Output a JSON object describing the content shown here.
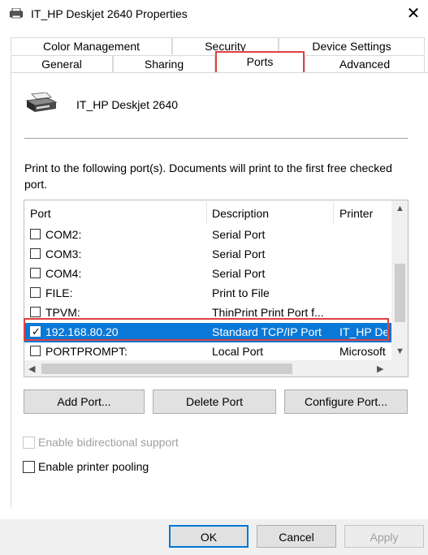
{
  "window": {
    "title": "IT_HP Deskjet 2640 Properties",
    "close_glyph": "✕"
  },
  "tabs_top": [
    {
      "label": "Color Management"
    },
    {
      "label": "Security"
    },
    {
      "label": "Device Settings"
    }
  ],
  "tabs_bottom": [
    {
      "label": "General"
    },
    {
      "label": "Sharing"
    },
    {
      "label": "Ports",
      "active": true
    },
    {
      "label": "Advanced"
    }
  ],
  "printer": {
    "name": "IT_HP Deskjet 2640"
  },
  "instructions": "Print to the following port(s). Documents will print to the first free checked port.",
  "ports_table": {
    "columns": [
      "Port",
      "Description",
      "Printer"
    ],
    "rows": [
      {
        "port": "COM2:",
        "description": "Serial Port",
        "printer": "",
        "checked": false,
        "selected": false
      },
      {
        "port": "COM3:",
        "description": "Serial Port",
        "printer": "",
        "checked": false,
        "selected": false
      },
      {
        "port": "COM4:",
        "description": "Serial Port",
        "printer": "",
        "checked": false,
        "selected": false
      },
      {
        "port": "FILE:",
        "description": "Print to File",
        "printer": "",
        "checked": false,
        "selected": false
      },
      {
        "port": "TPVM:",
        "description": "ThinPrint Print Port f...",
        "printer": "",
        "checked": false,
        "selected": false
      },
      {
        "port": "192.168.80.20",
        "description": "Standard TCP/IP Port",
        "printer": "IT_HP De",
        "checked": true,
        "selected": true
      },
      {
        "port": "PORTPROMPT:",
        "description": "Local Port",
        "printer": "Microsoft",
        "checked": false,
        "selected": false
      }
    ]
  },
  "port_buttons": {
    "add": "Add Port...",
    "delete": "Delete Port",
    "configure": "Configure Port..."
  },
  "options": {
    "bidirectional": {
      "label": "Enable bidirectional support",
      "checked": false,
      "enabled": false
    },
    "pooling": {
      "label": "Enable printer pooling",
      "checked": false,
      "enabled": true
    }
  },
  "dialog_buttons": {
    "ok": "OK",
    "cancel": "Cancel",
    "apply": "Apply"
  },
  "icons": {
    "printer": "printer-icon",
    "check": "✓",
    "scroll_up": "▲",
    "scroll_down": "▼",
    "scroll_left": "◀",
    "scroll_right": "▶"
  },
  "colors": {
    "selection": "#0a78d7",
    "highlight_box": "#e04040",
    "default_button_border": "#0078d7"
  }
}
